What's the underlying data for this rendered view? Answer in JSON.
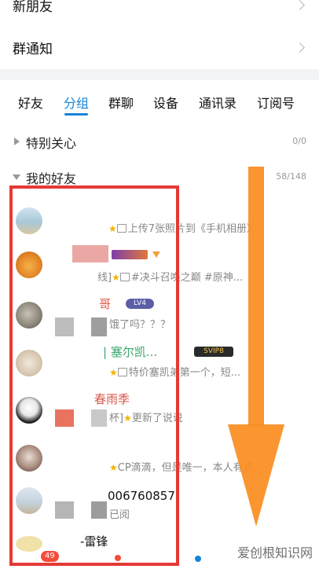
{
  "top_rows": [
    {
      "label": "新朋友"
    },
    {
      "label": "群通知"
    }
  ],
  "tabs": [
    {
      "label": "好友",
      "active": false
    },
    {
      "label": "分组",
      "active": true
    },
    {
      "label": "群聊",
      "active": false
    },
    {
      "label": "设备",
      "active": false
    },
    {
      "label": "通讯录",
      "active": false
    },
    {
      "label": "订阅号",
      "active": false
    }
  ],
  "groups": [
    {
      "name": "特别关心",
      "count": "0/0",
      "expanded": false
    },
    {
      "name": "我的好友",
      "count": "58/148",
      "expanded": true
    }
  ],
  "friends": [
    {
      "name": "",
      "status": "上传7张照片到《手机相册》",
      "status_prefix": ""
    },
    {
      "name": "",
      "status": "#决斗召唤之巅 #原神...",
      "status_prefix": "线]"
    },
    {
      "name": "哥",
      "status": "饿了吗？？？",
      "status_prefix": "",
      "level": "LV4"
    },
    {
      "name": "| 塞尔凯...",
      "status": "特价塞凯弟第一个，短...",
      "status_prefix": "",
      "vip": "SVIP8"
    },
    {
      "name": "春雨季",
      "status": "更新了说说",
      "status_prefix": "杯]"
    },
    {
      "name": "",
      "status": "CP滴滴，但是唯一，本人有点...",
      "status_prefix": ""
    },
    {
      "name": "006760857",
      "status": "已阅",
      "status_prefix": ""
    },
    {
      "name": "-雷锋",
      "status": "",
      "status_prefix": ""
    }
  ],
  "bottom": {
    "badge": "49"
  },
  "watermark": "爱创根知识网",
  "colors": {
    "accent": "#1683d8",
    "highlight_box": "#e53935",
    "arrow": "#fb8c1e",
    "badge": "#f44b3b"
  }
}
